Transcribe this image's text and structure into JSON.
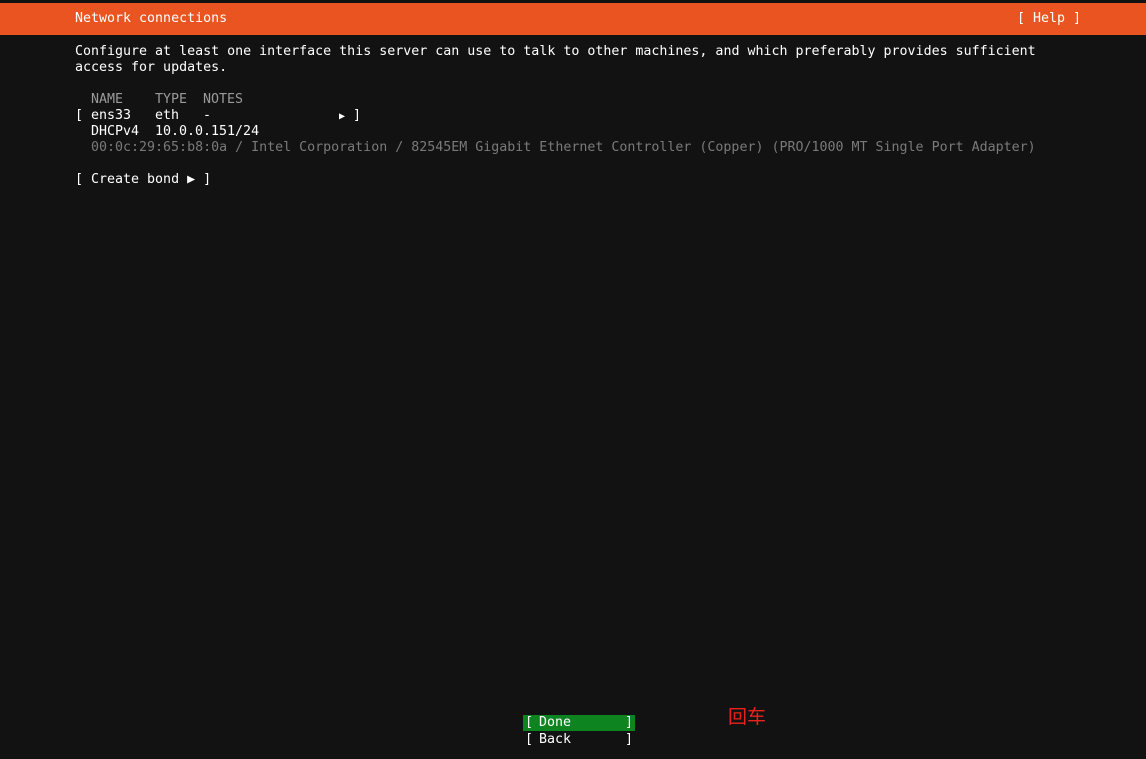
{
  "header": {
    "title": "Network connections",
    "help_label": "[ Help ]"
  },
  "description": {
    "line1": "Configure at least one interface this server can use to talk to other machines, and which preferably provides sufficient",
    "line2": "access for updates."
  },
  "table": {
    "columns": [
      "NAME",
      "TYPE",
      "NOTES"
    ],
    "interfaces": [
      {
        "open_bracket": "[",
        "name": "ens33",
        "type": "eth",
        "notes": "-",
        "arrow": "▶",
        "close_bracket": "]",
        "address_method": "DHCPv4",
        "address": "10.0.0.151/24",
        "hardware": "00:0c:29:65:b8:0a / Intel Corporation / 82545EM Gigabit Ethernet Controller (Copper) (PRO/1000 MT Single Port Adapter)"
      }
    ]
  },
  "create_bond_label": "[ Create bond ▶ ]",
  "buttons": {
    "done": {
      "open": "[",
      "label": "Done",
      "close": "]"
    },
    "back": {
      "open": "[",
      "label": "Back",
      "close": "]"
    }
  },
  "annotation": "回车",
  "colors": {
    "header_bg": "#e95420",
    "background": "#121212",
    "selected_button_bg": "#0e8420",
    "annotation": "#e8231f"
  }
}
